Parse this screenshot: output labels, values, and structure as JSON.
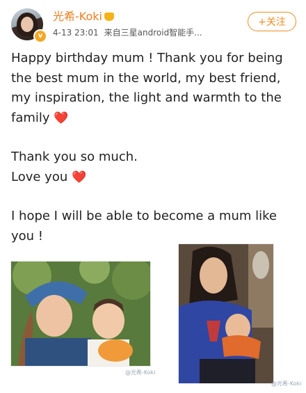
{
  "header": {
    "username": "光希-Koki",
    "timestamp": "4-13 23:01",
    "source": "来自三星android智能手...",
    "follow_label": "+关注",
    "verified_badge": "v"
  },
  "post": {
    "paragraph_1": "Happy birthday mum ! Thank you for being the best mum in the world, my best friend, my inspiration, the light and warmth to the family",
    "heart_1": "❤️",
    "line_thanks": "Thank you so much.",
    "line_love": "Love you",
    "heart_2": "❤️",
    "paragraph_3": "I hope I will be able to become a mum like you !"
  },
  "photos": {
    "watermark_1": "@光希-Koki",
    "watermark_2": "@光希-Koki"
  },
  "colors": {
    "accent": "#f08c1f",
    "username": "#ea7f22",
    "heart": "#e0242c"
  }
}
